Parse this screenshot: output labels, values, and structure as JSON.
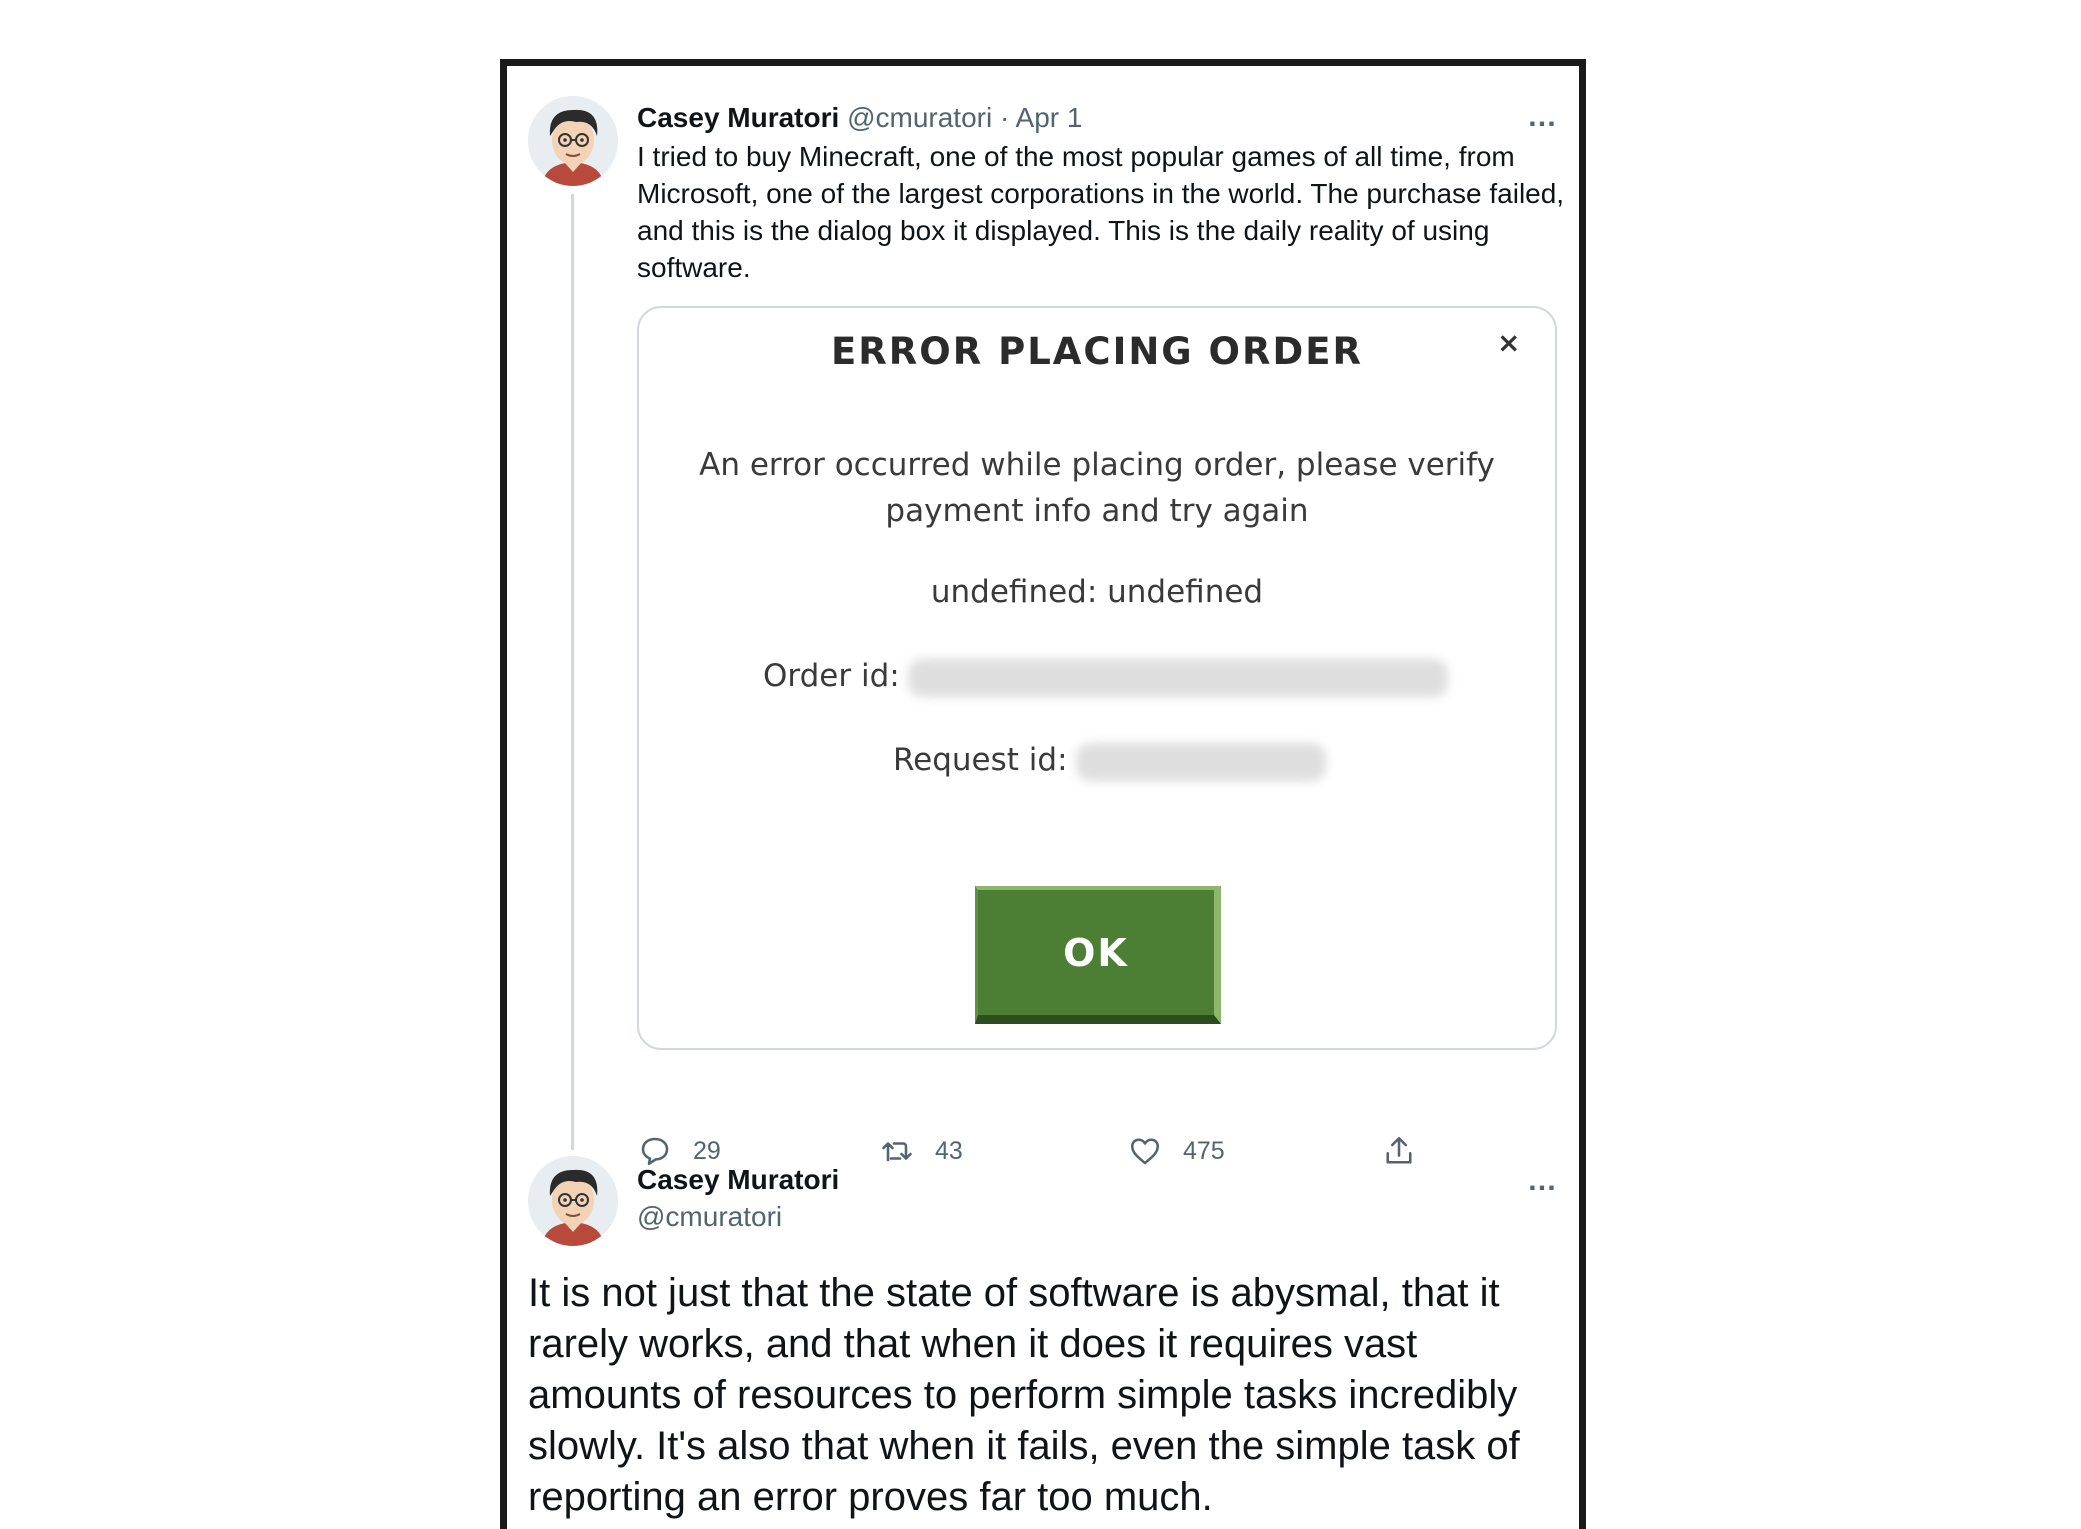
{
  "tweet1": {
    "author_name": "Casey Muratori",
    "handle": "@cmuratori",
    "separator": "·",
    "date": "Apr 1",
    "more_icon": "…",
    "text": "I tried to buy Minecraft, one of the most popular games of all time, from Microsoft, one of the largest corporations in the world. The purchase failed, and this is the dialog box it displayed. This is the daily reality of using software.",
    "media": {
      "title": "ERROR PLACING ORDER",
      "close_icon": "×",
      "message": "An error occurred while placing order, please verify payment info and try again",
      "error_detail": "undefined: undefined",
      "order_id_label": "Order id:",
      "request_id_label": "Request id:",
      "ok_label": "OK",
      "ok_color": "#4c7f34"
    },
    "actions": {
      "reply_count": "29",
      "retweet_count": "43",
      "like_count": "475",
      "icons": [
        "reply-icon",
        "retweet-icon",
        "like-icon",
        "share-icon"
      ]
    }
  },
  "tweet2": {
    "author_name": "Casey Muratori",
    "handle": "@cmuratori",
    "more_icon": "…",
    "text": "It is not just that the state of software is abysmal, that it rarely works, and that when it does it requires vast amounts of resources to perform simple tasks incredibly slowly. It's also that when it fails, even the simple task of reporting an error proves far too much."
  },
  "colors": {
    "text": "#0f1419",
    "muted": "#536471",
    "border": "#cfd9de",
    "frame": "#1a1a1a"
  }
}
